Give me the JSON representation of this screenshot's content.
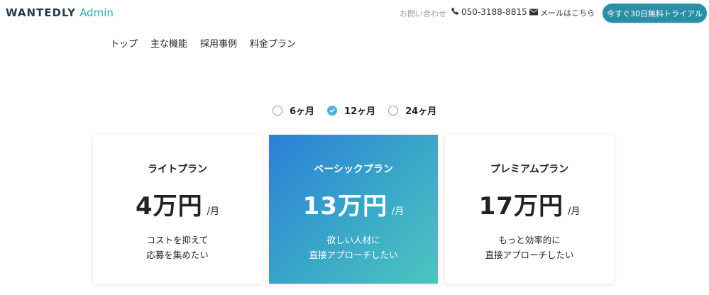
{
  "header": {
    "logo_brand": "WANTEDLY",
    "logo_sub": "Admin",
    "contact_label": "お問い合わせ",
    "phone": "050-3188-8815",
    "mail_label": "メールはこちら",
    "trial_button": "今すぐ30日無料トライアル"
  },
  "nav": {
    "items": [
      "トップ",
      "主な機能",
      "採用事例",
      "料金プラン"
    ]
  },
  "periods": {
    "options": [
      "6ヶ月",
      "12ヶ月",
      "24ヶ月"
    ],
    "selected": "12ヶ月"
  },
  "plans": [
    {
      "name": "ライトプラン",
      "price": "4万円",
      "unit": "/月",
      "desc_line1": "コストを抑えて",
      "desc_line2": "応募を集めたい"
    },
    {
      "name": "ベーシックプラン",
      "price": "13万円",
      "unit": "/月",
      "desc_line1": "欲しい人材に",
      "desc_line2": "直接アプローチしたい"
    },
    {
      "name": "プレミアムプラン",
      "price": "17万円",
      "unit": "/月",
      "desc_line1": "もっと効率的に",
      "desc_line2": "直接アプローチしたい"
    }
  ],
  "colors": {
    "accent": "#2a8fa6",
    "radio_checked": "#4ab3d8",
    "featured_gradient_start": "#2a7fd8",
    "featured_gradient_end": "#4cc5c0"
  }
}
